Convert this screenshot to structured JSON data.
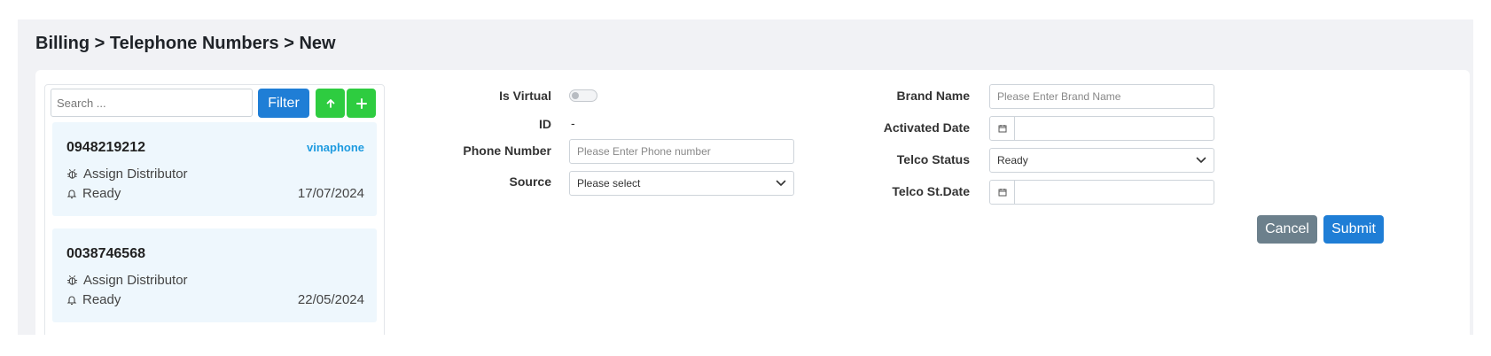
{
  "breadcrumb": "Billing > Telephone Numbers > New",
  "list": {
    "search_placeholder": "Search ...",
    "filter_label": "Filter",
    "items": [
      {
        "number": "0948219212",
        "carrier": "vinaphone",
        "assign_label": "Assign Distributor",
        "status": "Ready",
        "date": "17/07/2024"
      },
      {
        "number": "0038746568",
        "carrier": "",
        "assign_label": "Assign Distributor",
        "status": "Ready",
        "date": "22/05/2024"
      }
    ]
  },
  "form": {
    "is_virtual_label": "Is Virtual",
    "is_virtual_value": false,
    "id_label": "ID",
    "id_value": "-",
    "phone_label": "Phone Number",
    "phone_placeholder": "Please Enter Phone number",
    "source_label": "Source",
    "source_value": "Please select",
    "brand_label": "Brand Name",
    "brand_placeholder": "Please Enter Brand Name",
    "activated_label": "Activated Date",
    "telco_status_label": "Telco Status",
    "telco_status_value": "Ready",
    "telco_date_label": "Telco St.Date"
  },
  "actions": {
    "cancel_label": "Cancel",
    "submit_label": "Submit"
  },
  "icons": {
    "up": "arrow-up-icon",
    "add": "plus-icon",
    "assign": "bug-icon",
    "status": "bell-icon",
    "calendar": "calendar-icon",
    "dropdown": "chevron-down-icon"
  },
  "colors": {
    "primary": "#1f7ed6",
    "success": "#2ecc40",
    "secondary": "#6c808c",
    "carrier": "#1e9be0",
    "item_bg": "#eef7fd"
  }
}
